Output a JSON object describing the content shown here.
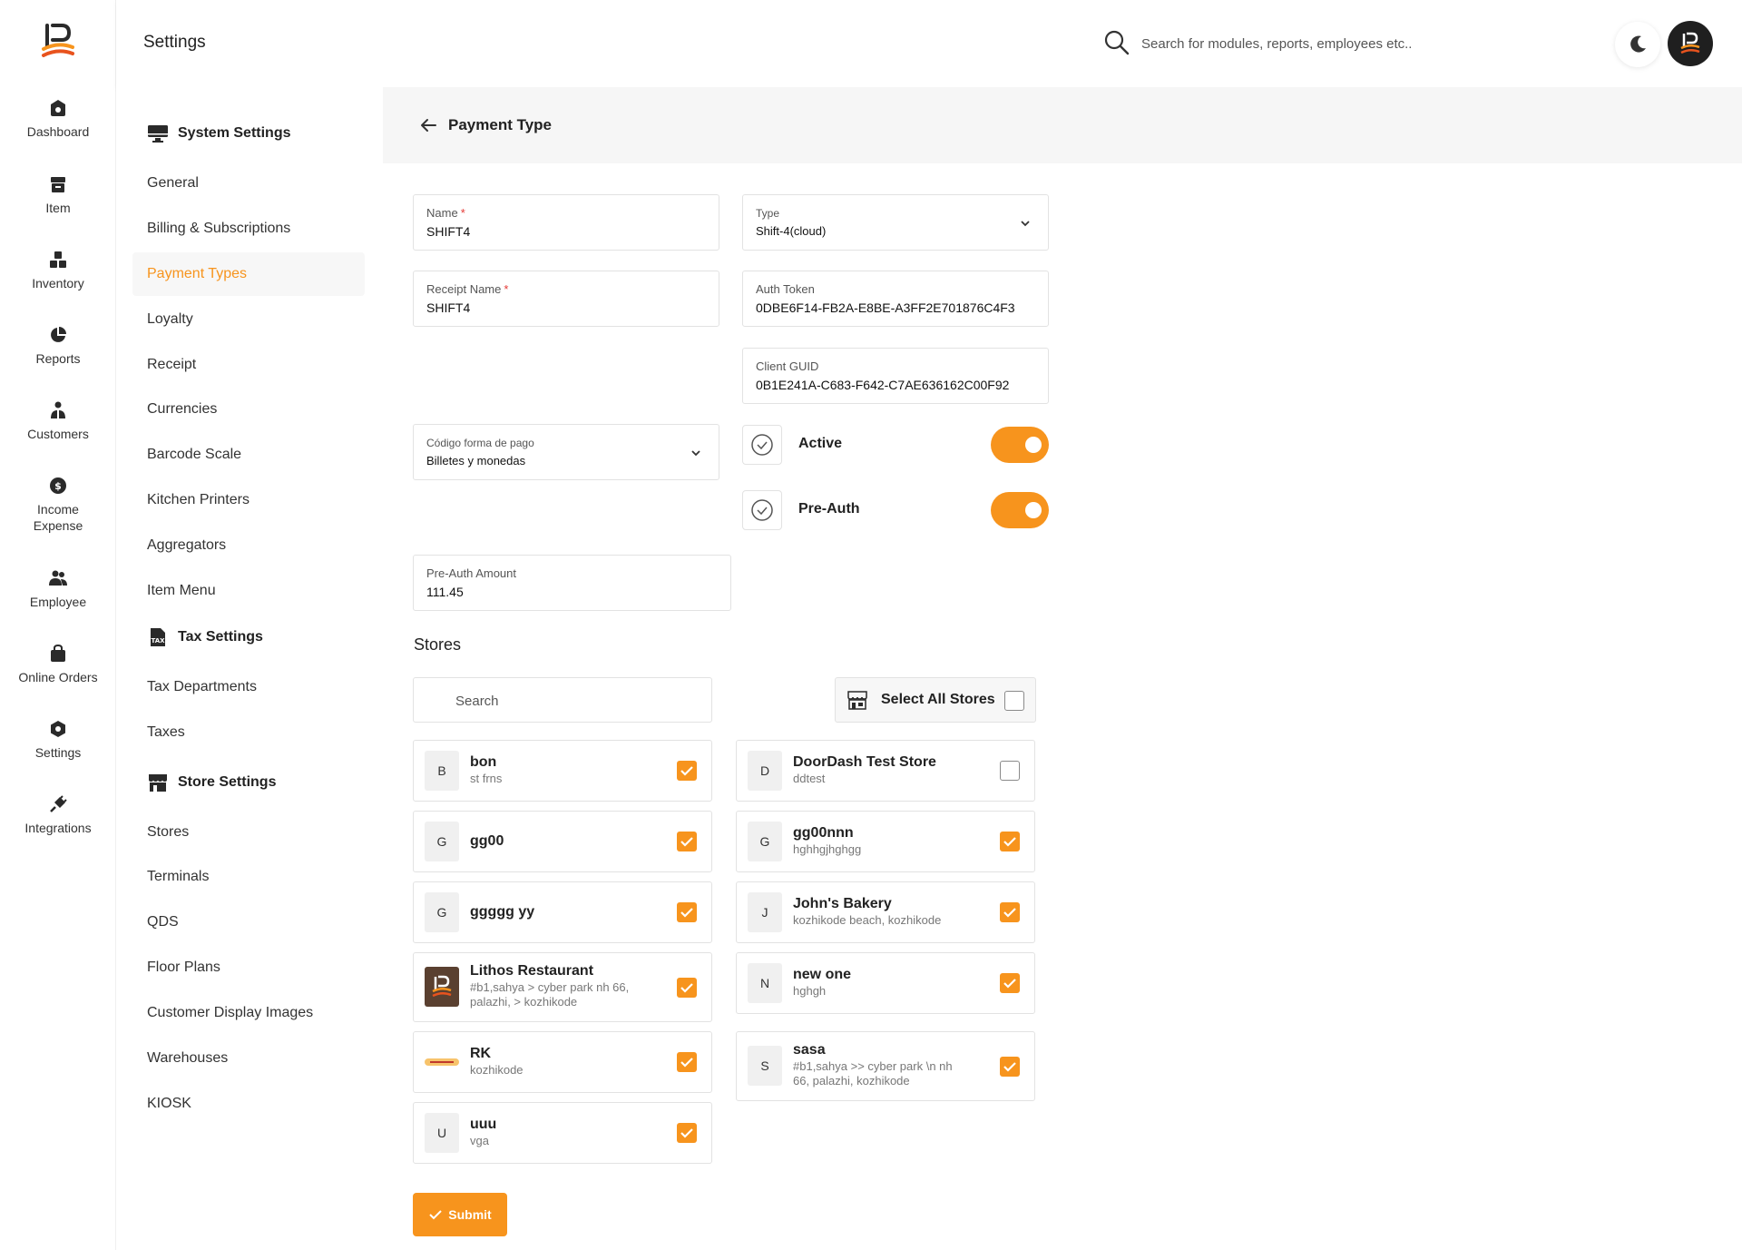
{
  "app": {
    "header_title": "Settings"
  },
  "search": {
    "placeholder": "Search for modules, reports, employees etc.."
  },
  "rail": [
    {
      "label": "Dashboard",
      "icon": "dashboard-icon"
    },
    {
      "label": "Item",
      "icon": "item-icon"
    },
    {
      "label": "Inventory",
      "icon": "inventory-icon"
    },
    {
      "label": "Reports",
      "icon": "pie-chart-icon"
    },
    {
      "label": "Customers",
      "icon": "customers-icon"
    },
    {
      "label": "Income\nExpense",
      "icon": "dollar-icon"
    },
    {
      "label": "Employee",
      "icon": "employee-icon"
    },
    {
      "label": "Online Orders",
      "icon": "bag-icon"
    },
    {
      "label": "Settings",
      "icon": "gear-icon"
    },
    {
      "label": "Integrations",
      "icon": "plug-icon"
    }
  ],
  "sidebar": {
    "sections": [
      {
        "label": "System Settings",
        "icon": "monitor-icon"
      },
      {
        "label": "Tax Settings",
        "icon": "tax-document-icon"
      },
      {
        "label": "Store Settings",
        "icon": "store-icon"
      }
    ],
    "items": [
      "General",
      "Billing & Subscriptions",
      "Payment Types",
      "Loyalty",
      "Receipt",
      "Currencies",
      "Barcode Scale",
      "Kitchen Printers",
      "Aggregators",
      "Item Menu",
      "Tax Departments",
      "Taxes",
      "Stores",
      "Terminals",
      "QDS",
      "Floor Plans",
      "Customer Display Images",
      "Warehouses",
      "KIOSK"
    ],
    "active_item": "Payment Types"
  },
  "page": {
    "title": "Payment Type"
  },
  "form": {
    "name": {
      "label": "Name",
      "value": "SHIFT4",
      "required": "*"
    },
    "type": {
      "label": "Type",
      "value": "Shift-4(cloud)"
    },
    "receipt_name": {
      "label": "Receipt Name",
      "value": "SHIFT4",
      "required": "*"
    },
    "auth_token": {
      "label": "Auth Token",
      "value": "0DBE6F14-FB2A-E8BE-A3FF2E701876C4F3"
    },
    "client_guid": {
      "label": "Client GUID",
      "value": "0B1E241A-C683-F642-C7AE636162C00F92"
    },
    "codigo": {
      "label": "Código forma de pago",
      "value": "Billetes y monedas"
    },
    "active": {
      "label": "Active",
      "on": true
    },
    "pre_auth": {
      "label": "Pre-Auth",
      "on": true
    },
    "pre_auth_amount": {
      "label": "Pre-Auth Amount",
      "value": "111.45"
    }
  },
  "stores": {
    "title": "Stores",
    "search_placeholder": "Search",
    "select_all_label": "Select All Stores",
    "select_all_checked": false,
    "left": [
      {
        "badge": "B",
        "name": "bon",
        "sub": "st frns",
        "checked": true
      },
      {
        "badge": "G",
        "name": "gg00",
        "sub": "",
        "checked": true
      },
      {
        "badge": "G",
        "name": "ggggg yy",
        "sub": "",
        "checked": true
      },
      {
        "badge": "logo",
        "name": "Lithos Restaurant",
        "sub": "#b1,sahya > cyber park nh 66, palazhi, > kozhikode",
        "checked": true
      },
      {
        "badge": "fiery-hut-logo",
        "name": "RK",
        "sub": "kozhikode",
        "checked": true
      },
      {
        "badge": "U",
        "name": "uuu",
        "sub": "vga",
        "checked": true
      }
    ],
    "right": [
      {
        "badge": "D",
        "name": "DoorDash Test Store",
        "sub": "ddtest",
        "checked": false
      },
      {
        "badge": "G",
        "name": "gg00nnn",
        "sub": "hghhgjhghgg",
        "checked": true
      },
      {
        "badge": "J",
        "name": "John's Bakery",
        "sub": "kozhikode beach, kozhikode",
        "checked": true
      },
      {
        "badge": "N",
        "name": "new one",
        "sub": "hghgh",
        "checked": true
      },
      {
        "badge": "S",
        "name": "sasa",
        "sub": "#b1,sahya >> cyber park \\n nh 66, palazhi, kozhikode",
        "checked": true
      }
    ]
  },
  "submit_label": "Submit",
  "colors": {
    "accent": "#f7941d",
    "dark": "#1f1f1f",
    "required": "#e53935"
  }
}
